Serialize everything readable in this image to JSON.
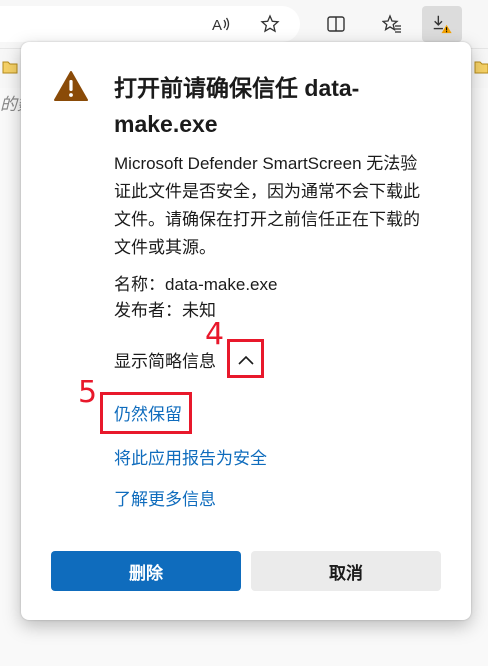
{
  "page": {
    "partial_text": "的数"
  },
  "toolbar": {
    "read_aloud_icon": "read-aloud-icon",
    "favorite_icon": "star-icon",
    "split_icon": "split-screen-icon",
    "favorites_icon": "favorites-icon",
    "downloads_icon": "download-warning-icon"
  },
  "dialog": {
    "title": "打开前请确保信任 data-make.exe",
    "body": "Microsoft Defender SmartScreen 无法验证此文件是否安全，因为通常不会下载此文件。请确保在打开之前信任正在下载的文件或其源。",
    "name_line": "名称：data-make.exe",
    "publisher_line": "发布者：未知",
    "toggle_label": "显示简略信息",
    "links": {
      "keep": "仍然保留",
      "report": "将此应用报告为安全",
      "more": "了解更多信息"
    },
    "buttons": {
      "delete": "删除",
      "cancel": "取消"
    },
    "colors": {
      "accent": "#0f6cbd",
      "warning": "#8a4b08"
    }
  },
  "annotations": {
    "step4": "4",
    "step5": "5",
    "color": "#e8182b"
  }
}
